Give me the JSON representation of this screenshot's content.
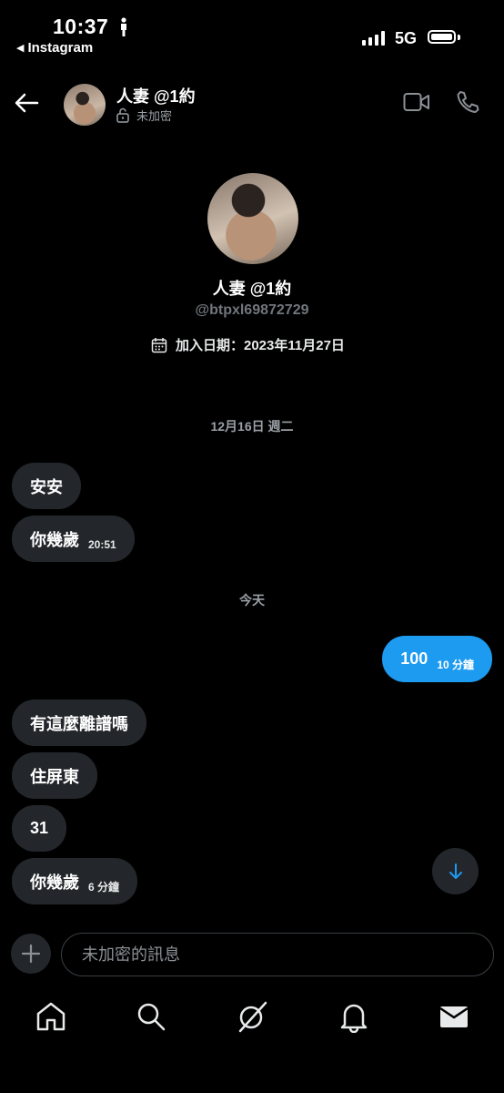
{
  "status_bar": {
    "time": "10:37",
    "back_app": "Instagram",
    "network": "5G"
  },
  "header": {
    "name": "人妻 @1約",
    "encryption": "未加密"
  },
  "profile": {
    "name": "人妻 @1約",
    "handle": "@btpxl69872729",
    "joined": "加入日期：2023年11月27日"
  },
  "messages": {
    "date_1": "12月16日 週二",
    "m1": {
      "text": "安安"
    },
    "m2": {
      "text": "你幾歲",
      "time": "20:51"
    },
    "date_2": "今天",
    "m3": {
      "text": "100",
      "time": "10 分鐘"
    },
    "m4": {
      "text": "有這麼離譜嗎"
    },
    "m5": {
      "text": "住屏東"
    },
    "m6": {
      "text": "31"
    },
    "m7": {
      "text": "你幾歲",
      "time": "6 分鐘"
    }
  },
  "composer": {
    "placeholder": "未加密的訊息"
  },
  "colors": {
    "accent": "#1d9bf0",
    "bubble": "#23272b",
    "background": "#000000"
  }
}
